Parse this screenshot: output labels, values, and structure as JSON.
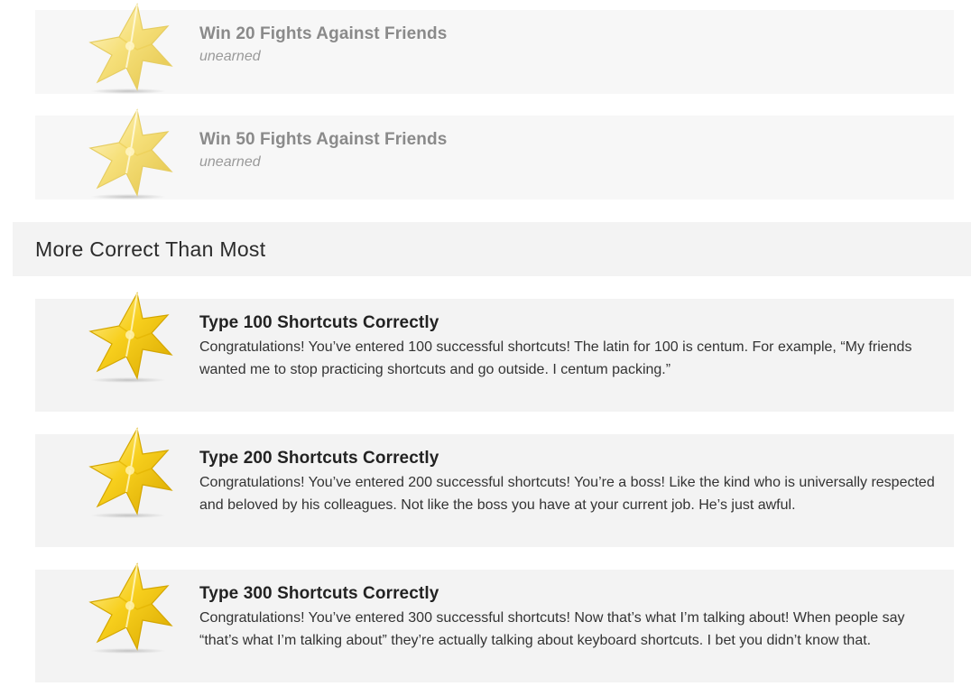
{
  "achievements_top": [
    {
      "title": "Win 20 Fights Against Friends",
      "status": "unearned",
      "icon": "star-badge-icon"
    },
    {
      "title": "Win 50 Fights Against Friends",
      "status": "unearned",
      "icon": "star-badge-icon"
    }
  ],
  "section": {
    "title": "More Correct Than Most"
  },
  "achievements": [
    {
      "title": "Type 100 Shortcuts Correctly",
      "description": "Congratulations! You’ve entered 100 successful shortcuts! The latin for 100 is centum. For example, “My friends wanted me to stop practicing shortcuts and go outside. I centum packing.”",
      "icon": "star-badge-icon"
    },
    {
      "title": "Type 200 Shortcuts Correctly",
      "description": "Congratulations! You’ve entered 200 successful shortcuts! You’re a boss! Like the kind who is universally respected and beloved by his colleagues. Not like the boss you have at your current job. He’s just awful.",
      "icon": "star-badge-icon"
    },
    {
      "title": "Type 300 Shortcuts Correctly",
      "description": "Congratulations! You’ve entered 300 successful shortcuts! Now that’s what I’m talking about! When people say “that’s what I’m talking about” they’re actually talking about keyboard shortcuts. I bet you didn’t know that.",
      "icon": "star-badge-icon"
    }
  ],
  "colors": {
    "badge_earned": "#f5c518",
    "badge_unearned": "#f3dc74",
    "card_bg": "#f3f3f3",
    "card_bg_unearned": "#f7f7f7"
  }
}
